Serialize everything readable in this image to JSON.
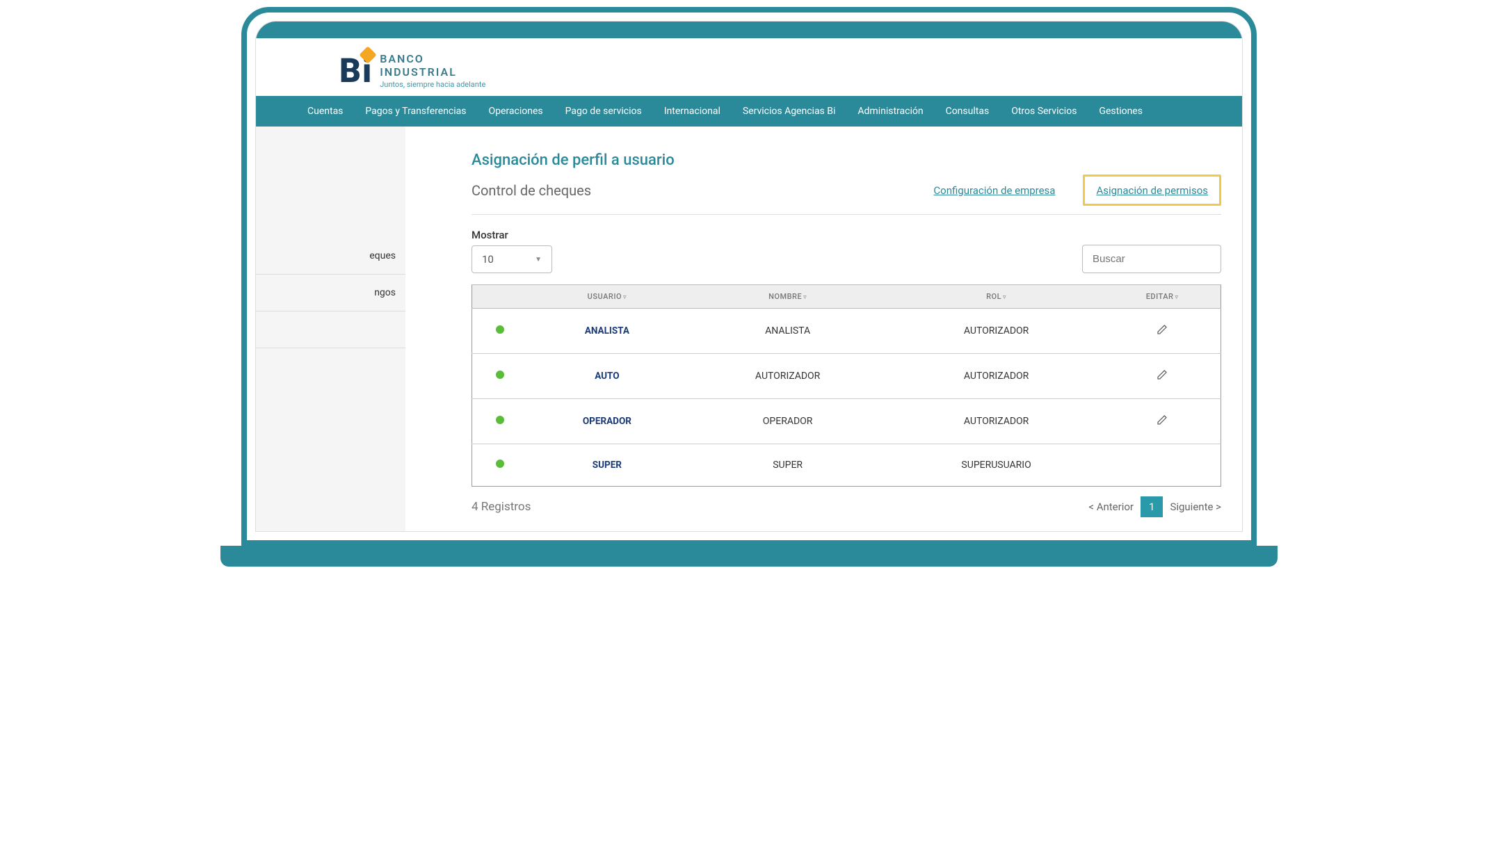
{
  "logo": {
    "line1": "BANCO",
    "line2": "INDUSTRIAL",
    "tagline": "Juntos, siempre hacia adelante"
  },
  "nav": {
    "items": [
      "Cuentas",
      "Pagos y Transferencias",
      "Operaciones",
      "Pago de servicios",
      "Internacional",
      "Servicios Agencias Bi",
      "Administración",
      "Consultas",
      "Otros Servicios",
      "Gestiones"
    ]
  },
  "sidebar": {
    "items": [
      "eques",
      "ngos"
    ]
  },
  "page": {
    "title": "Asignación de perfil a usuario",
    "subtitle": "Control de cheques",
    "links": {
      "config": "Configuración de empresa",
      "permisos": "Asignación de permisos"
    }
  },
  "controls": {
    "show_label": "Mostrar",
    "show_value": "10",
    "search_placeholder": "Buscar"
  },
  "table": {
    "headers": {
      "status": "",
      "usuario": "USUARIO",
      "nombre": "NOMBRE",
      "rol": "ROL",
      "editar": "EDITAR"
    },
    "rows": [
      {
        "usuario": "ANALISTA",
        "nombre": "ANALISTA",
        "rol": "AUTORIZADOR",
        "editable": true
      },
      {
        "usuario": "AUTO",
        "nombre": "AUTORIZADOR",
        "rol": "AUTORIZADOR",
        "editable": true
      },
      {
        "usuario": "OPERADOR",
        "nombre": "OPERADOR",
        "rol": "AUTORIZADOR",
        "editable": true
      },
      {
        "usuario": "SUPER",
        "nombre": "SUPER",
        "rol": "SUPERUSUARIO",
        "editable": false
      }
    ]
  },
  "footer": {
    "records": "4 Registros",
    "prev": "< Anterior",
    "page": "1",
    "next": "Siguiente >"
  }
}
